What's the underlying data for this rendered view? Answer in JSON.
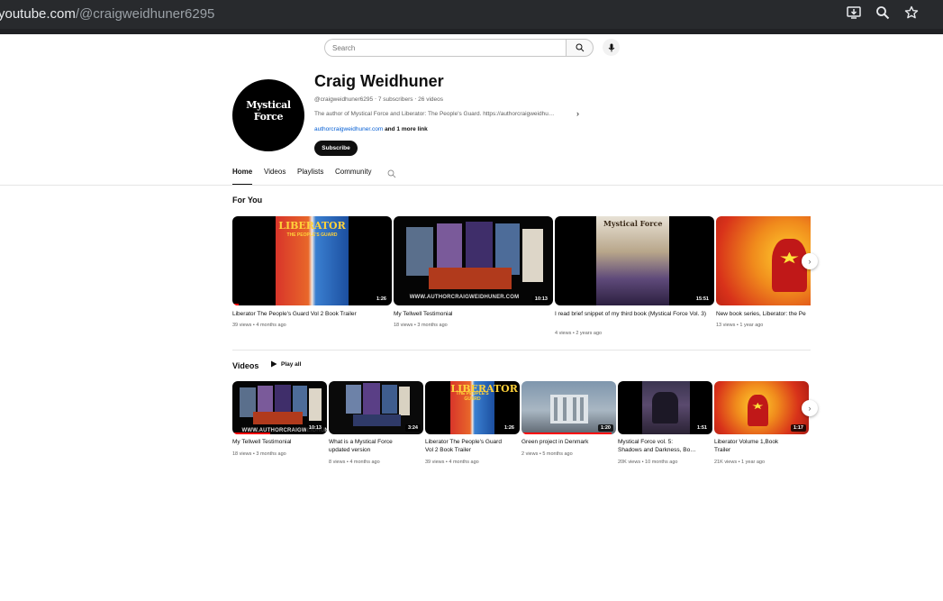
{
  "browser": {
    "url_domain": "youtube.com",
    "url_path": "/@craigweidhuner6295"
  },
  "search": {
    "placeholder": "Search"
  },
  "channel": {
    "avatar_line1": "Mystical",
    "avatar_line2": "Force",
    "name": "Craig Weidhuner",
    "handle": "@craigweidhuner6295",
    "subscribers": "7 subscribers",
    "videos_count": "26 videos",
    "description": "The author of Mystical Force and Liberator: The People's Guard. https://authorcraigweidhu…",
    "link": "authorcraigweidhuner.com",
    "more_links": "and 1 more link",
    "subscribe_label": "Subscribe"
  },
  "tabs": [
    {
      "label": "Home",
      "active": true
    },
    {
      "label": "Videos",
      "active": false
    },
    {
      "label": "Playlists",
      "active": false
    },
    {
      "label": "Community",
      "active": false
    }
  ],
  "for_you": {
    "title": "For You",
    "items": [
      {
        "title": "Liberator The People's Guard Vol 2 Book Trailer",
        "meta": "39 views • 4 months ago",
        "duration": "1:26",
        "thumb": "liberator",
        "progress": 0.05
      },
      {
        "title": "My Tellwell Testimonial",
        "meta": "18 views • 3 months ago",
        "duration": "10:13",
        "thumb": "books",
        "progress": 0
      },
      {
        "title": "I read brief snippet of my third book (Mystical Force Vol. 3)",
        "meta": "4 views • 2 years ago",
        "duration": "15:51",
        "thumb": "mystical",
        "progress": 0
      },
      {
        "title": "New book series, Liberator: the Pe",
        "meta": "13 views • 1 year ago",
        "duration": "",
        "thumb": "hero",
        "progress": 0
      }
    ]
  },
  "videos": {
    "title": "Videos",
    "play_all_label": "Play all",
    "items": [
      {
        "title_1": "My Tellwell Testimonial",
        "title_2": "",
        "meta": "18 views • 3 months ago",
        "duration": "10:13",
        "thumb": "books",
        "progress": 0.4
      },
      {
        "title_1": "What is a Mystical Force",
        "title_2": "updated version",
        "meta": "8 views • 4 months ago",
        "duration": "3:24",
        "thumb": "books2",
        "progress": 0
      },
      {
        "title_1": "Liberator The People's Guard",
        "title_2": "Vol 2 Book Trailer",
        "meta": "39 views • 4 months ago",
        "duration": "1:26",
        "thumb": "liberator",
        "progress": 0
      },
      {
        "title_1": "Green project in Denmark",
        "title_2": "",
        "meta": "2 views • 5 months ago",
        "duration": "1:20",
        "thumb": "building",
        "progress": 0.95
      },
      {
        "title_1": "Mystical Force vol. 5:",
        "title_2": "Shadows and Darkness, Bo…",
        "meta": "20K views • 10 months ago",
        "duration": "1:51",
        "thumb": "dark",
        "progress": 0
      },
      {
        "title_1": "Liberator Volume 1,Book",
        "title_2": "Trailer",
        "meta": "21K views • 1 year ago",
        "duration": "1:17",
        "thumb": "hero",
        "progress": 0
      }
    ]
  },
  "thumb_captions": {
    "liberator_title": "LIBERATOR",
    "liberator_sub": "THE PEOPLE'S GUARD",
    "books_url": "WWW.AUTHORCRAIGWEIDHUNER.COM",
    "mystical_title": "Mystical Force"
  }
}
